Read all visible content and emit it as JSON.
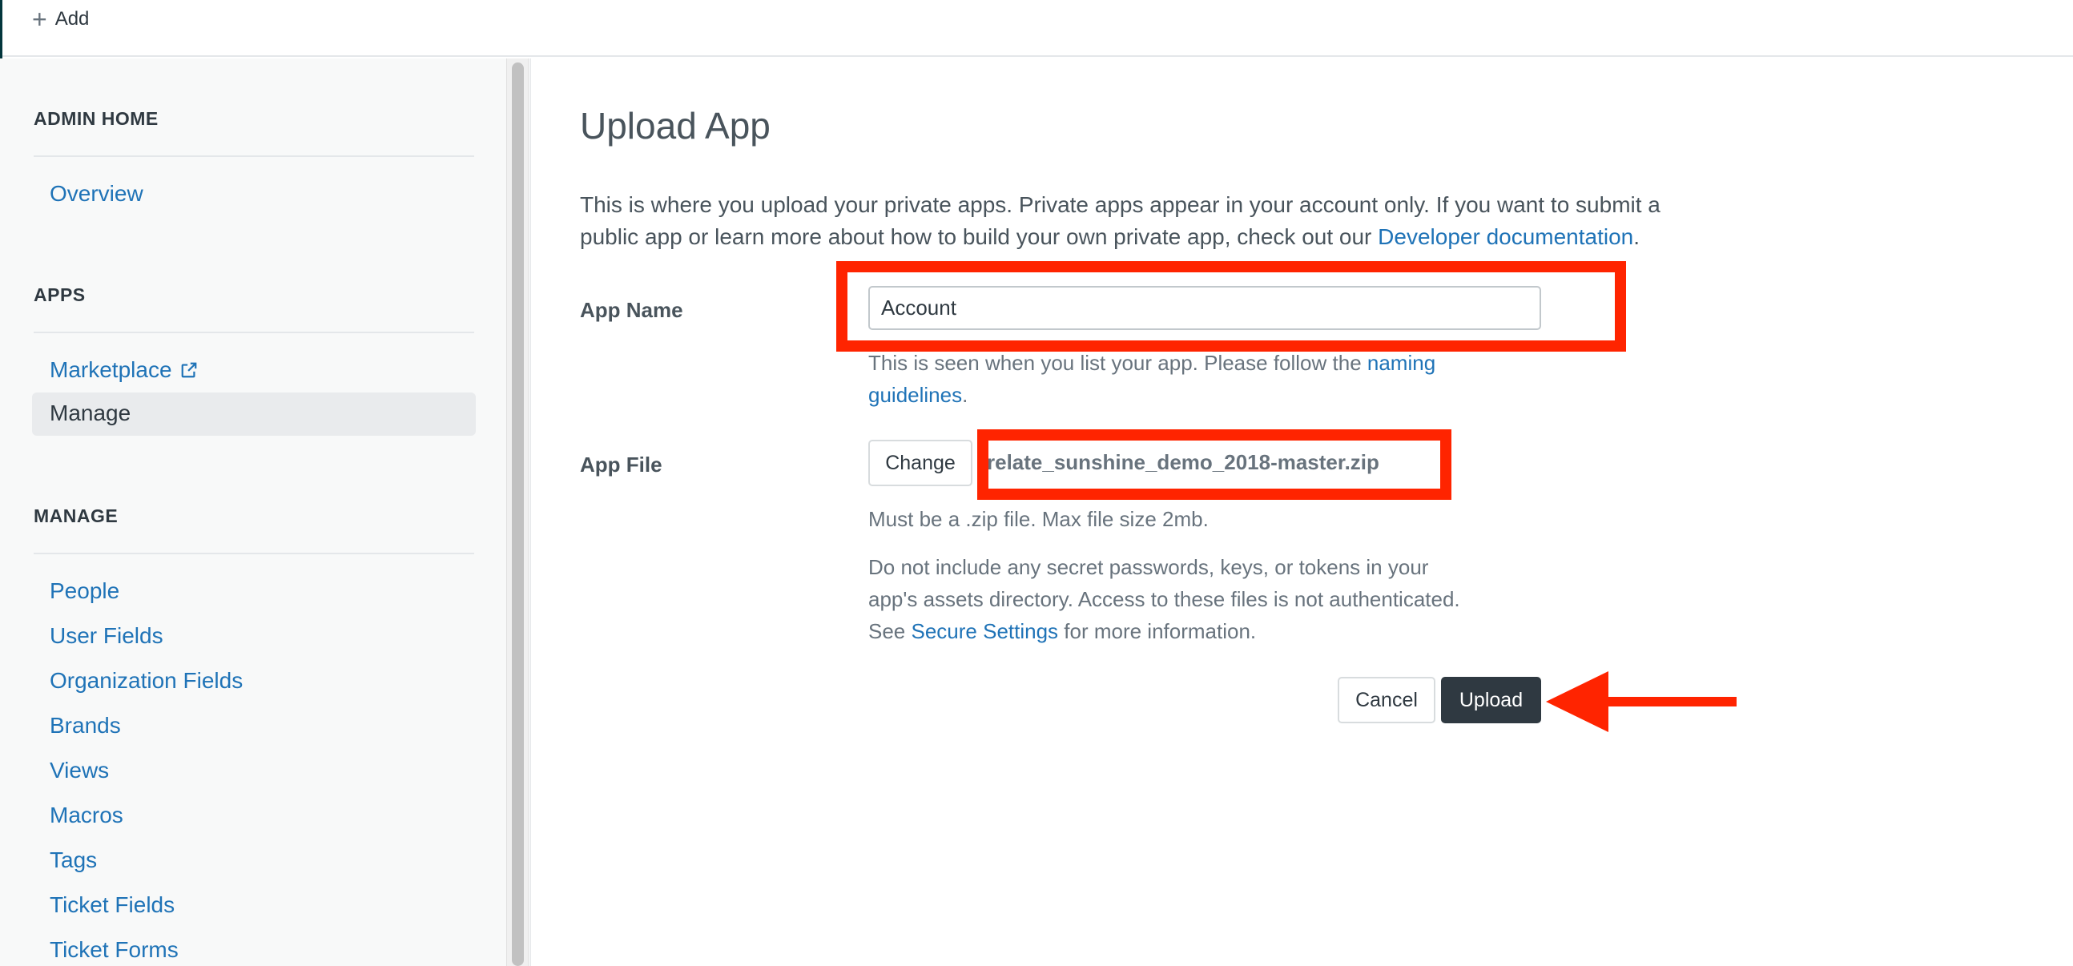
{
  "topbar": {
    "add_label": "Add"
  },
  "sidebar": {
    "sections": [
      {
        "title": "ADMIN HOME",
        "items": [
          {
            "label": "Overview"
          }
        ]
      },
      {
        "title": "APPS",
        "items": [
          {
            "label": "Marketplace"
          },
          {
            "label": "Manage",
            "active": true
          }
        ]
      },
      {
        "title": "MANAGE",
        "items": [
          {
            "label": "People"
          },
          {
            "label": "User Fields"
          },
          {
            "label": "Organization Fields"
          },
          {
            "label": "Brands"
          },
          {
            "label": "Views"
          },
          {
            "label": "Macros"
          },
          {
            "label": "Tags"
          },
          {
            "label": "Ticket Fields"
          },
          {
            "label": "Ticket Forms"
          }
        ]
      }
    ]
  },
  "main": {
    "title": "Upload App",
    "intro_line1": "This is where you upload your private apps. Private apps appear in your account only. If you want to submit a",
    "intro_line2_prefix": "public app or learn more about how to build your own private app, check out our ",
    "intro_link": "Developer documentation",
    "intro_suffix": ".",
    "app_name": {
      "label": "App Name",
      "value": "Account",
      "help_prefix": "This is seen when you list your app. Please follow the ",
      "help_link_1": "naming",
      "help_link_2": "guidelines",
      "help_suffix": "."
    },
    "app_file": {
      "label": "App File",
      "change_label": "Change",
      "file_name": "relate_sunshine_demo_2018-master.zip",
      "help_size": "Must be a .zip file. Max file size 2mb.",
      "warn_line1": "Do not include any secret passwords, keys, or tokens in your",
      "warn_line2": "app's assets directory. Access to these files is not authenticated.",
      "warn_line3_prefix": "See ",
      "warn_link": "Secure Settings",
      "warn_line3_suffix": " for more information."
    },
    "actions": {
      "cancel_label": "Cancel",
      "upload_label": "Upload"
    }
  },
  "annotations": {
    "color": "#ff2400",
    "icons": [
      "external-link-icon",
      "plus-icon",
      "arrow-left-icon"
    ]
  }
}
